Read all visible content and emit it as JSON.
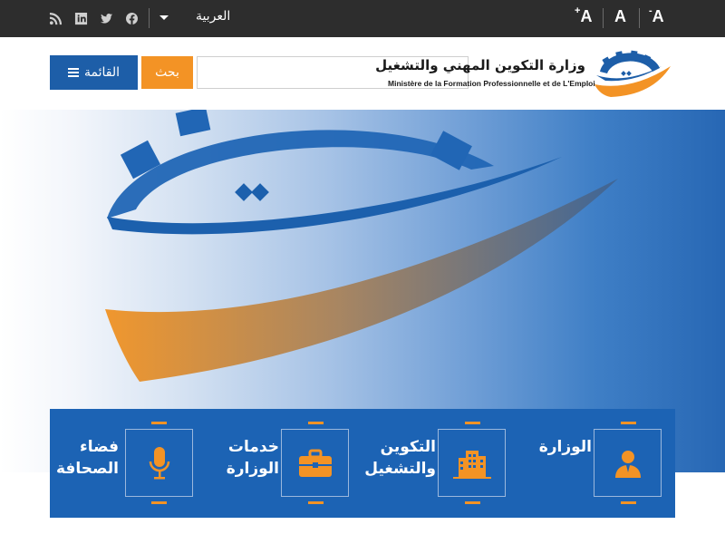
{
  "topbar": {
    "language_label": "العربية",
    "font_controls": {
      "decrease": "A",
      "decrease_sign": "-",
      "normal": "A",
      "increase": "A",
      "increase_sign": "+"
    },
    "social_icons": [
      "rss-icon",
      "linkedin-icon",
      "twitter-icon",
      "facebook-icon"
    ]
  },
  "header": {
    "menu_label": "القائمة",
    "search_label": "بحث",
    "search_placeholder": "",
    "ministry_name_ar": "وزارة التكوين المهني والتشغيل",
    "ministry_name_fr": "Ministère de la Formation Professionnelle et de L'Emploi"
  },
  "services": [
    {
      "label": "الوزارة",
      "icon": "person-icon"
    },
    {
      "label": "التكوين والتشغيل",
      "icon": "building-icon"
    },
    {
      "label": "خدمات الوزارة",
      "icon": "briefcase-icon"
    },
    {
      "label": "فضاء الصحافة",
      "icon": "microphone-icon"
    }
  ],
  "colors": {
    "topbar": "#2d2d2d",
    "primary_blue": "#1d5ea8",
    "accent_orange": "#f39325",
    "services_bg": "#1c63b4"
  }
}
